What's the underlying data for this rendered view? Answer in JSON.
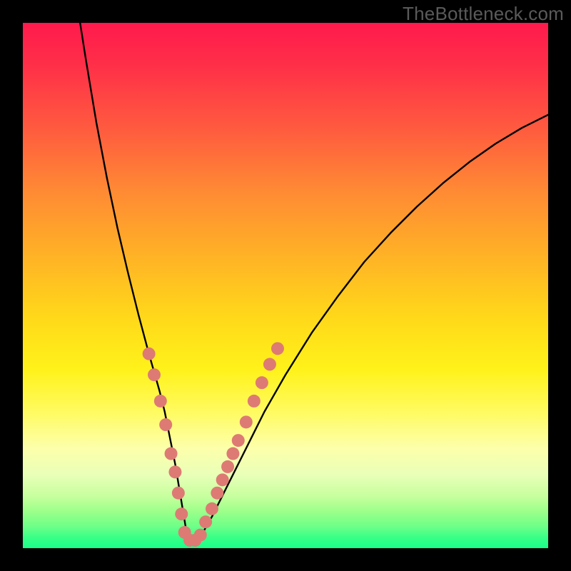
{
  "watermark_text": "TheBottleneck.com",
  "chart_data": {
    "type": "line",
    "title": "",
    "xlabel": "",
    "ylabel": "",
    "xlim": [
      0,
      100
    ],
    "ylim": [
      0,
      100
    ],
    "grid": false,
    "legend": false,
    "series": [
      {
        "name": "curve",
        "color": "#000000",
        "x": [
          10.9,
          12,
          14,
          16,
          18,
          20,
          22,
          24,
          26,
          27,
          28,
          29,
          30,
          31,
          32,
          33,
          34,
          36,
          38,
          40,
          42,
          44,
          46,
          50,
          55,
          60,
          65,
          70,
          75,
          80,
          85,
          90,
          95,
          100
        ],
        "y": [
          100,
          93,
          81,
          70.5,
          61,
          52.5,
          44.5,
          37,
          30,
          26,
          21,
          16,
          10,
          4,
          1.5,
          1.5,
          2.5,
          6,
          10,
          14,
          18,
          22,
          26,
          33,
          41,
          48,
          54.5,
          60,
          65,
          69.5,
          73.5,
          77,
          80,
          82.5
        ]
      }
    ],
    "markers": [
      {
        "name": "salmon-dots",
        "color": "#de7a74",
        "radius_px": 9,
        "points": [
          {
            "x": 24.0,
            "y": 37.0
          },
          {
            "x": 25.0,
            "y": 33.0
          },
          {
            "x": 26.2,
            "y": 28.0
          },
          {
            "x": 27.2,
            "y": 23.5
          },
          {
            "x": 28.2,
            "y": 18.0
          },
          {
            "x": 29.0,
            "y": 14.5
          },
          {
            "x": 29.6,
            "y": 10.5
          },
          {
            "x": 30.2,
            "y": 6.5
          },
          {
            "x": 30.8,
            "y": 3.0
          },
          {
            "x": 31.8,
            "y": 1.5
          },
          {
            "x": 32.8,
            "y": 1.5
          },
          {
            "x": 33.8,
            "y": 2.5
          },
          {
            "x": 34.8,
            "y": 5.0
          },
          {
            "x": 36.0,
            "y": 7.5
          },
          {
            "x": 37.0,
            "y": 10.5
          },
          {
            "x": 38.0,
            "y": 13.0
          },
          {
            "x": 39.0,
            "y": 15.5
          },
          {
            "x": 40.0,
            "y": 18.0
          },
          {
            "x": 41.0,
            "y": 20.5
          },
          {
            "x": 42.5,
            "y": 24.0
          },
          {
            "x": 44.0,
            "y": 28.0
          },
          {
            "x": 45.5,
            "y": 31.5
          },
          {
            "x": 47.0,
            "y": 35.0
          },
          {
            "x": 48.5,
            "y": 38.0
          }
        ]
      }
    ],
    "background_gradient": {
      "stops": [
        {
          "pos": 0.0,
          "color": "#ff1a4d"
        },
        {
          "pos": 0.56,
          "color": "#ffd81a"
        },
        {
          "pos": 1.0,
          "color": "#1aff8a"
        }
      ]
    }
  }
}
